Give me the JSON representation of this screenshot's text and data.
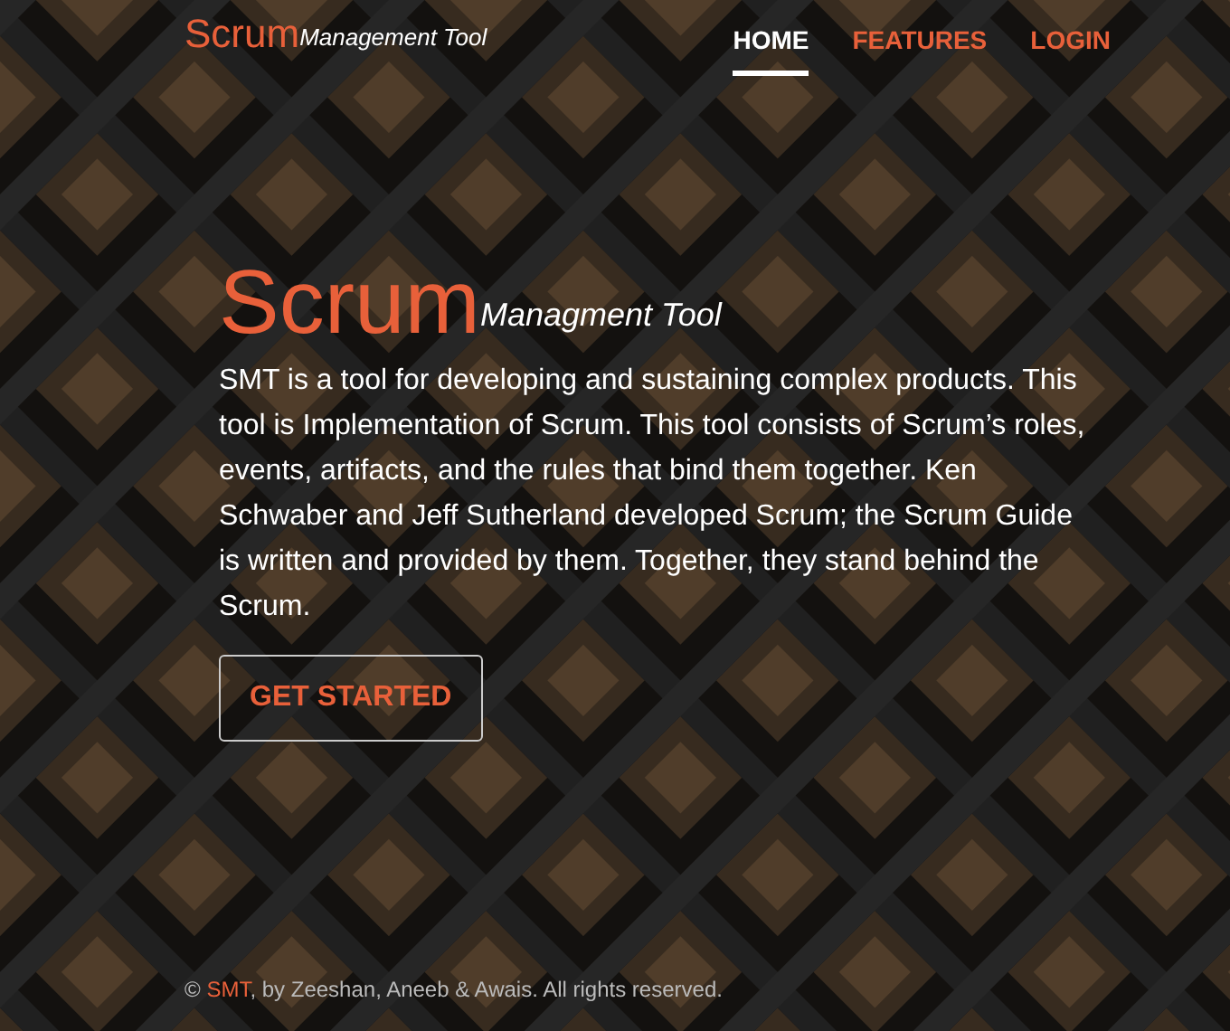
{
  "brand": {
    "name": "Scrum",
    "tagline": "Management Tool"
  },
  "nav": [
    {
      "label": "HOME",
      "selected": true
    },
    {
      "label": "FEATURES",
      "selected": false
    },
    {
      "label": "LOGIN",
      "selected": false
    }
  ],
  "hero": {
    "title": "Scrum",
    "subtitle": "Managment Tool",
    "text": "SMT is a tool for developing and sustaining complex products. This tool is Implementation of Scrum. This tool consists of Scrum’s roles, events, artifacts, and the rules that bind them together. Ken Schwaber and Jeff Sutherland developed Scrum; the Scrum Guide is written and provided by them. Together, they stand behind the Scrum.",
    "button": "GET STARTED"
  },
  "footer": {
    "prefix": "©",
    "link": "SMT",
    "suffix": ", by Zeeshan, Aneeb & Awais. All rights reserved."
  }
}
